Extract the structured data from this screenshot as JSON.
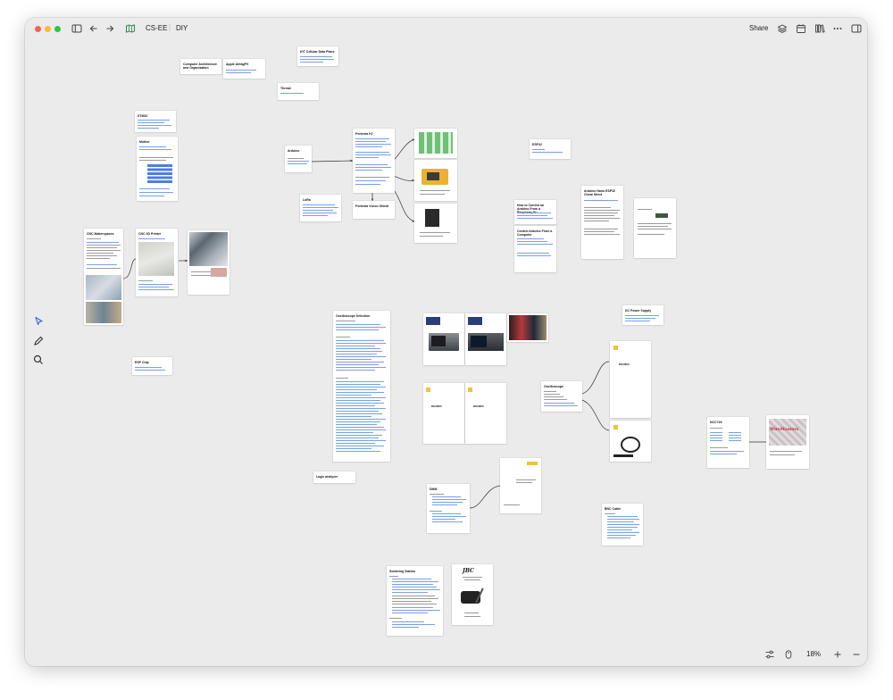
{
  "window": {
    "title": "DIY",
    "breadcrumb": "CS-EE",
    "share_label": "Share",
    "zoom": "18%"
  },
  "cards": {
    "computer_arch": "Computer Architecture and Organization",
    "apple_airtag": "Apple AirtagPX",
    "iot_hub": "IOT Cellular Data Plans",
    "thread": "Thread",
    "stm32": "STM32",
    "mother": "Mother",
    "arduino": "Arduino",
    "portenta_h7": "Portenta H7",
    "lora": "LoRa",
    "portenta_vision": "Portenta Vision Shield",
    "esp32": "ESP32",
    "control_arduino_pi": "How to Control an Arduino From a Raspberry Pi",
    "control_arduino_pc": "Control Arduino From a Computer",
    "nano_esp32": "Arduino Nano ESP32 Cheat Sheet",
    "cnc_makerspace": "CNC Makerspaces",
    "cnc_3d_printer": "CNC 3D Printer",
    "esp_chip": "ESP Chip",
    "osc_selection": "Oscilloscope Selection",
    "dc_power": "DC Power Supply",
    "oscilloscope": "Oscilloscope",
    "logic_analyzer": "Logic analyzer",
    "dmm": "DMM",
    "bnc_cable": "BNC Cable",
    "ncc_tools": "NCC718",
    "soldering": "Soldering Station",
    "dho_doc": "DHO800",
    "jbc_brand": "JBC",
    "wiremasters": "WireMasters"
  }
}
